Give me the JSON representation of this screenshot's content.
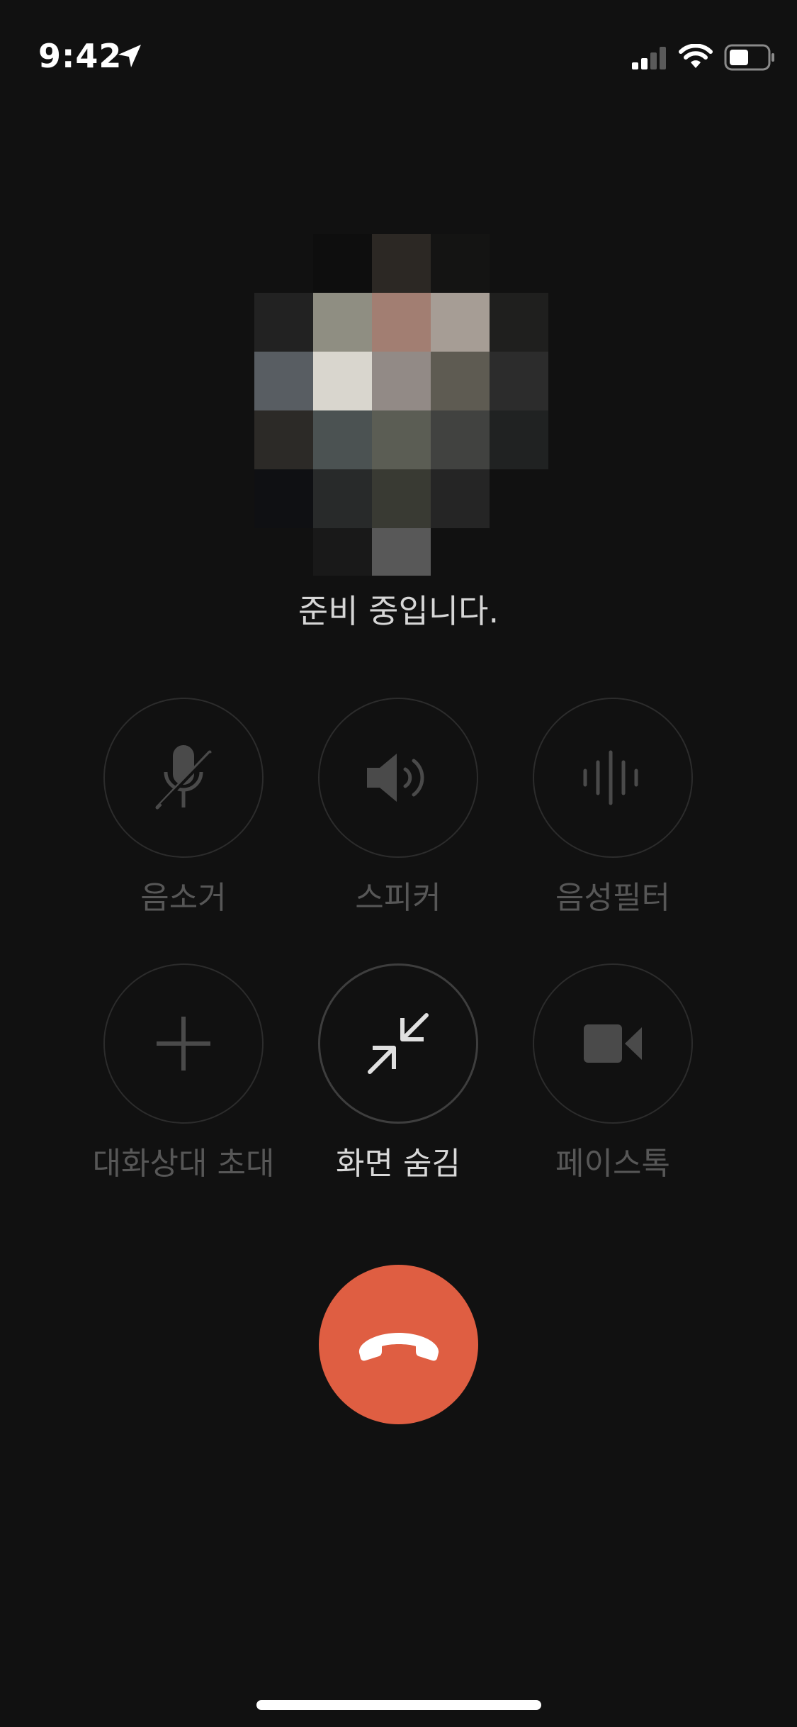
{
  "status_bar": {
    "time": "9:42"
  },
  "call": {
    "status_text": "준비 중입니다."
  },
  "controls": [
    {
      "label": "음소거",
      "icon": "mic-off-icon"
    },
    {
      "label": "스피커",
      "icon": "speaker-icon"
    },
    {
      "label": "음성필터",
      "icon": "voice-filter-icon"
    },
    {
      "label": "대화상대 초대",
      "icon": "plus-icon"
    },
    {
      "label": "화면 숨김",
      "icon": "minimize-icon"
    },
    {
      "label": "페이스톡",
      "icon": "video-camera-icon"
    }
  ],
  "colors": {
    "background": "#111111",
    "end_call": "#df5e42",
    "disabled_text": "#575757",
    "active_text": "#d8d8d8"
  }
}
